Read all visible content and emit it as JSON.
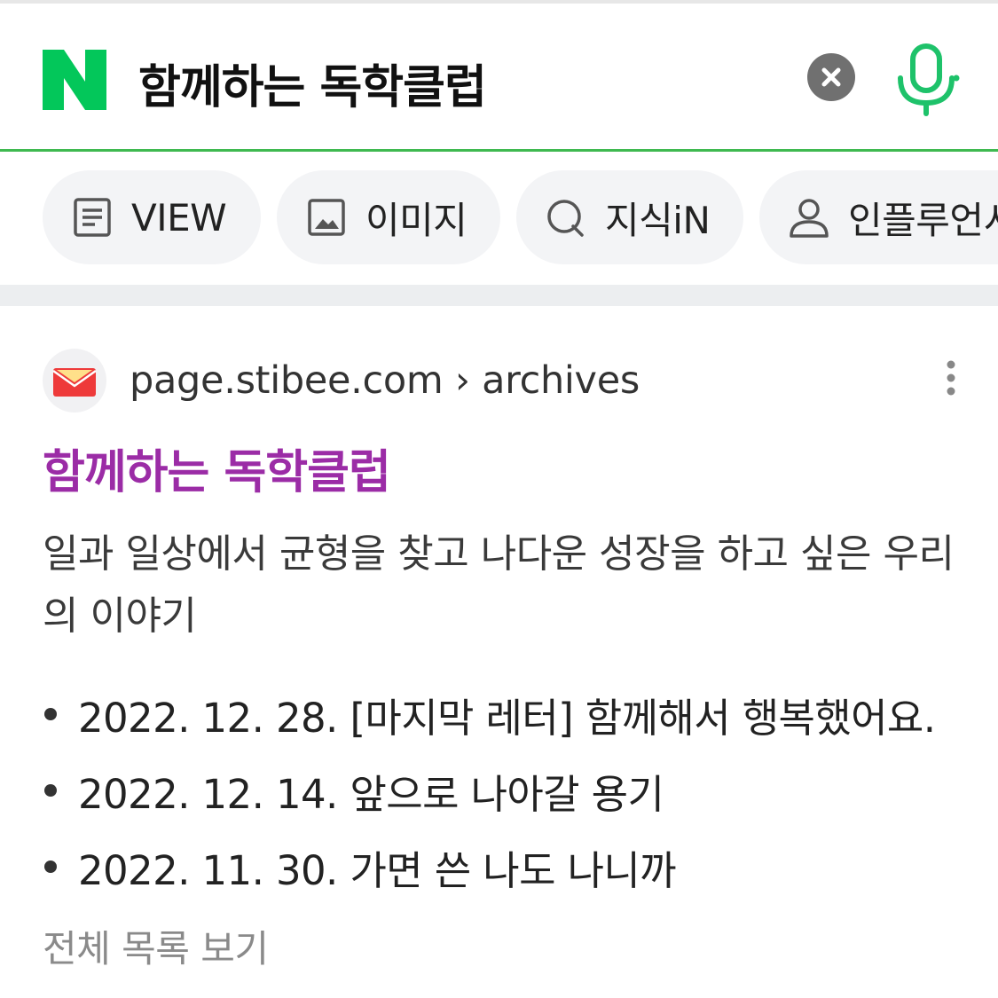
{
  "search": {
    "query": "함께하는 독학클럽",
    "logo_letter": "N",
    "logo_icon": "naver-logo-icon",
    "clear_icon": "close-icon",
    "voice_icon": "microphone-icon"
  },
  "tabs": [
    {
      "label": "VIEW",
      "icon": "document-icon"
    },
    {
      "label": "이미지",
      "icon": "image-icon"
    },
    {
      "label": "지식iN",
      "icon": "q-icon"
    },
    {
      "label": "인플루언서",
      "icon": "person-icon"
    }
  ],
  "result": {
    "favicon_icon": "envelope-icon",
    "source": "page.stibee.com › archives",
    "title": "함께하는 독학클럽",
    "description": "일과 일상에서 균형을 찾고 나다운 성장을 하고 싶은 우리의 이야기",
    "links": [
      "2022. 12. 28. [마지막 레터] 함께해서 행복했어요.",
      "2022. 12. 14. 앞으로 나아갈 용기",
      "2022. 11. 30. 가면 쓴 나도 나니까"
    ],
    "view_all": "전체 목록 보기",
    "more_icon": "more-vertical-icon"
  },
  "colors": {
    "brand_green": "#03c75a",
    "divider_green": "#3fb950",
    "title_purple": "#9b2ca6",
    "tab_bg": "#f3f4f6"
  }
}
